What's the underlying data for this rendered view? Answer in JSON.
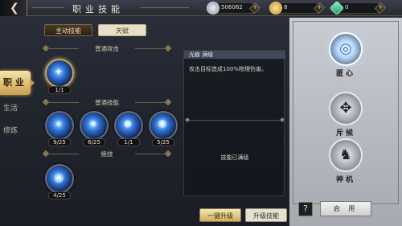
{
  "header": {
    "title": "职业技能",
    "resources": [
      {
        "icon": "silver-coin-icon",
        "value": "506062"
      },
      {
        "icon": "gold-ingot-icon",
        "value": "8"
      },
      {
        "icon": "jade-gem-icon",
        "value": "0"
      }
    ]
  },
  "left_tabs": [
    {
      "label": "职 业",
      "active": true
    },
    {
      "label": "生活",
      "active": false
    },
    {
      "label": "修炼",
      "active": false
    }
  ],
  "subtabs": {
    "active": "主动技能",
    "talent": "天赋"
  },
  "sections": {
    "normal_attack": "普通攻击",
    "normal_skills": "普通技能",
    "ultimate": "绝技"
  },
  "skills": {
    "normal_attack": [
      {
        "level": "1/1",
        "glyph": "✦"
      }
    ],
    "normal_skills": [
      {
        "level": "9/25",
        "glyph": "✶"
      },
      {
        "level": "6/25",
        "glyph": "✷"
      },
      {
        "level": "1/1",
        "glyph": "✹"
      },
      {
        "level": "5/25",
        "glyph": "✺"
      }
    ],
    "ultimate": [
      {
        "level": "4/25",
        "glyph": "◉"
      }
    ]
  },
  "info": {
    "header": "光痕 满级",
    "description": "攻击目标造成100%物理伤害。",
    "max_level_text": "技能已满级"
  },
  "buttons": {
    "one_key_upgrade": "一键升级",
    "upgrade_skill": "升级技能"
  },
  "schools": [
    {
      "name": "匿心",
      "icon": "spiral-eye-icon",
      "glyph": "◎",
      "selected": true
    },
    {
      "name": "斥候",
      "icon": "scout-mask-icon",
      "glyph": "✥",
      "selected": false
    },
    {
      "name": "神机",
      "icon": "mech-beast-icon",
      "glyph": "♞",
      "selected": false
    }
  ],
  "right": {
    "help": "?",
    "enable": "启 用"
  }
}
